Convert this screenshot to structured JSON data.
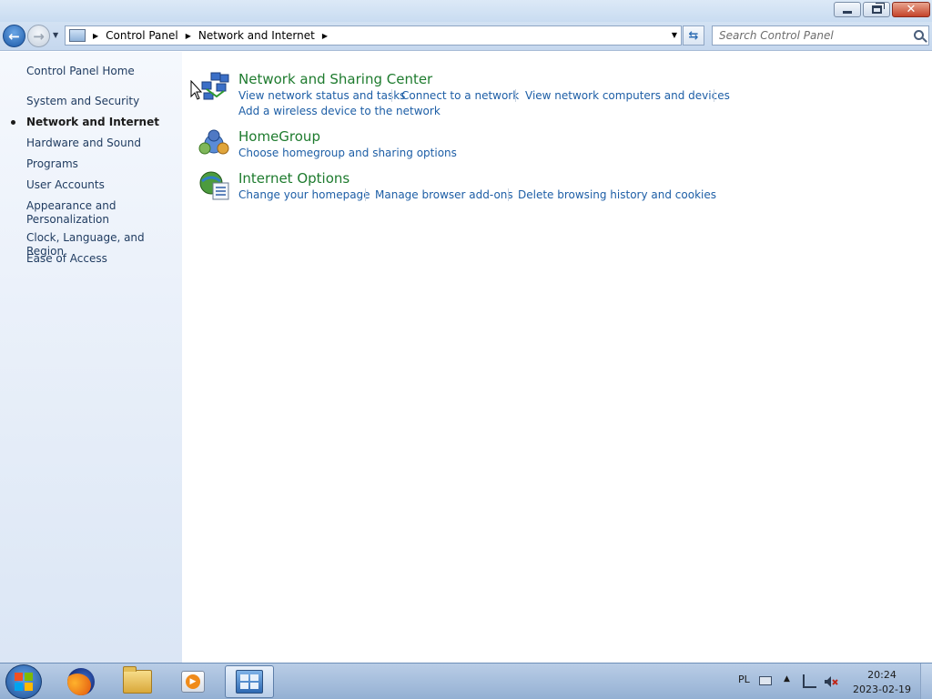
{
  "window": {
    "caption_buttons": {
      "minimize": "minimize-icon",
      "maximize": "restore-icon",
      "close": "close-icon"
    }
  },
  "address": {
    "crumbs": [
      "Control Panel",
      "Network and Internet"
    ],
    "search_placeholder": "Search Control Panel"
  },
  "sidebar": {
    "home": "Control Panel Home",
    "items": [
      {
        "label": "System and Security"
      },
      {
        "label": "Network and Internet",
        "active": true
      },
      {
        "label": "Hardware and Sound"
      },
      {
        "label": "Programs"
      },
      {
        "label": "User Accounts"
      },
      {
        "label_line1": "Appearance and",
        "label_line2": "Personalization"
      },
      {
        "label": "Clock, Language, and Region"
      },
      {
        "label": "Ease of Access"
      }
    ]
  },
  "categories": [
    {
      "title": "Network and Sharing Center",
      "icon": "network-icon",
      "links": [
        "View network status and tasks",
        "Connect to a network",
        "View network computers and devices",
        "Add a wireless device to the network"
      ]
    },
    {
      "title": "HomeGroup",
      "icon": "homegroup-icon",
      "links": [
        "Choose homegroup and sharing options"
      ]
    },
    {
      "title": "Internet Options",
      "icon": "internet-options-icon",
      "links": [
        "Change your homepage",
        "Manage browser add-ons",
        "Delete browsing history and cookies"
      ]
    }
  ],
  "taskbar": {
    "apps": [
      "firefox-icon",
      "file-explorer-icon",
      "media-player-icon",
      "control-panel-icon"
    ],
    "language": "PL",
    "time": "20:24",
    "date": "2023-02-19"
  },
  "colors": {
    "link": "#1d5ea6",
    "category_title": "#1e7b2e",
    "sidebar_text": "#1e3a5f"
  }
}
